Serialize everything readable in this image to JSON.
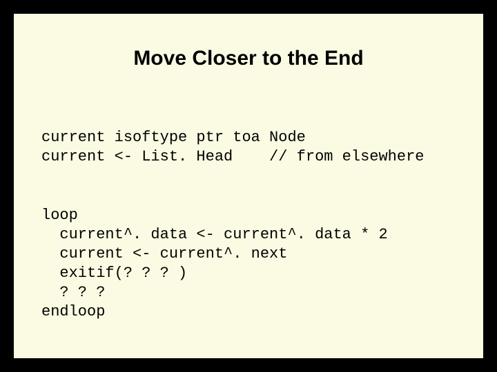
{
  "title": "Move Closer to the End",
  "code": {
    "l1": "current isoftype ptr toa Node",
    "l2": "current <- List. Head    // from elsewhere",
    "l3": "loop",
    "l4": "  current^. data <- current^. data * 2",
    "l5": "  current <- current^. next",
    "l6": "  exitif(? ? ? )",
    "l7": "  ? ? ?",
    "l8": "endloop"
  }
}
